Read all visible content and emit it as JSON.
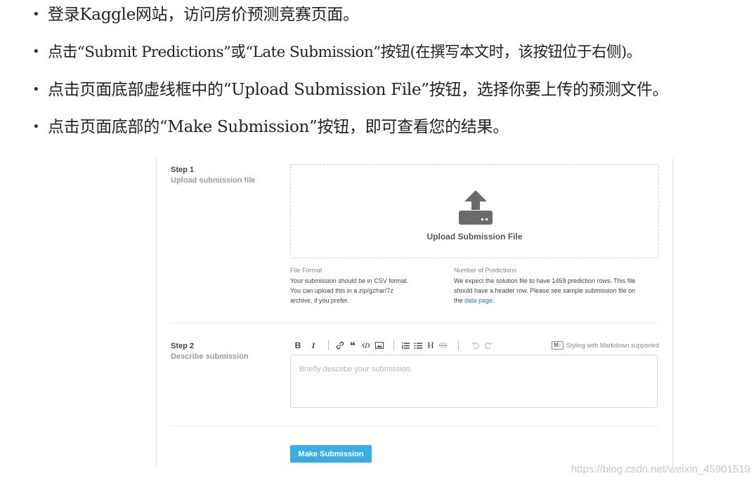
{
  "bullets": [
    "登录Kaggle网站，访问房价预测竞赛页面。",
    "点击“Submit Predictions”或“Late Submission”按钮(在撰写本文时，该按钮位于右侧)。",
    "点击页面底部虚线框中的“Upload Submission File”按钮，选择你要上传的预测文件。",
    "点击页面底部的“Make Submission”按钮，即可查看您的结果。"
  ],
  "bullet_glyph": "•",
  "step1": {
    "title": "Step 1",
    "subtitle": "Upload submission file",
    "upload_label": "Upload Submission File",
    "file_format": {
      "label": "File Format",
      "lines": [
        "Your submission should be in CSV format.",
        "You can upload this in a zip/gz/rar/7z",
        "archive, if you prefer."
      ]
    },
    "num_predictions": {
      "label": "Number of Predictions",
      "lines": [
        "We expect the solution file to have 1459 prediction rows. This file",
        "should have a header row. Please see sample submission file on"
      ],
      "line3_prefix": "the ",
      "link_text": "data page",
      "line3_suffix": "."
    }
  },
  "step2": {
    "title": "Step 2",
    "subtitle": "Describe submission",
    "toolbar": {
      "bold": "B",
      "italic": "I",
      "heading": "H",
      "markdown_badge": "M↓",
      "markdown_note": "Styling with Markdown supported"
    },
    "placeholder": "Briefly describe your submission."
  },
  "submit_label": "Make Submission",
  "watermark": "https://blog.csdn.net/weixin_45901519",
  "colors": {
    "accent": "#3aaee3",
    "link": "#1a7ec4",
    "icon": "#6b6b6b"
  }
}
